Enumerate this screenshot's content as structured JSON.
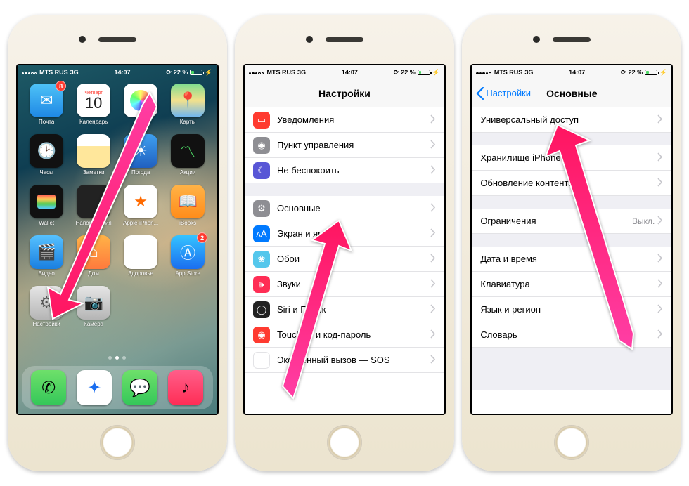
{
  "status": {
    "carrier": "MTS RUS",
    "network": "3G",
    "time": "14:07",
    "battery_pct": "22 %"
  },
  "home": {
    "calendar_weekday": "Четверг",
    "calendar_day": "10",
    "apps": {
      "mail": "Почта",
      "calendar": "Календарь",
      "photos": "Фото",
      "maps": "Карты",
      "clock": "Часы",
      "notes": "Заметки",
      "weather": "Погода",
      "stocks": "Акции",
      "wallet": "Wallet",
      "reminders": "Напоминания",
      "appleiphone": "Apple-iPhon...",
      "ibooks": "iBooks",
      "videos": "Видео",
      "home": "Дом",
      "health": "Здоровье",
      "appstore": "App Store",
      "settings": "Настройки",
      "camera": "Камера"
    },
    "badges": {
      "mail": "8",
      "appstore": "2"
    }
  },
  "settings": {
    "title": "Настройки",
    "rows": {
      "notifications": "Уведомления",
      "control_center": "Пункт управления",
      "dnd": "Не беспокоить",
      "general": "Основные",
      "display": "Экран и яркость",
      "wallpaper": "Обои",
      "sounds": "Звуки",
      "siri": "Siri и Поиск",
      "touchid": "Touch ID и код-пароль",
      "sos": "Экстренный вызов — SOS"
    }
  },
  "general": {
    "back": "Настройки",
    "title": "Основные",
    "rows": {
      "accessibility": "Универсальный доступ",
      "storage": "Хранилище iPhone",
      "bgrefresh": "Обновление контента",
      "restrictions": "Ограничения",
      "restrictions_val": "Выкл.",
      "datetime": "Дата и время",
      "keyboard": "Клавиатура",
      "language": "Язык и регион",
      "dictionary": "Словарь"
    }
  }
}
